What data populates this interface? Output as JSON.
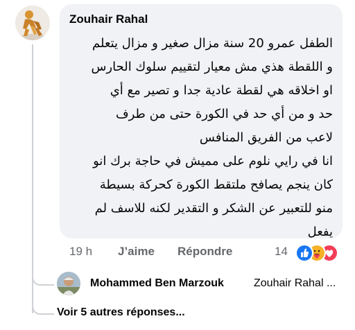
{
  "comment": {
    "author": "Zouhair Rahal",
    "text_lines": [
      "الطفل عمرو 20 سنة مزال صغير و مزال يتعلم",
      "و اللقطة هذي مش معيار لتقييم سلوك الحارس",
      "او اخلاقه هي لقطة عادية جدا و تصير مع أي",
      "حد و من أي حد في الكورة حتى من طرف",
      "لاعب من الفريق المنافس",
      "انا في رايي نلوم على مميش في حاجة برك انو",
      "كان ينجم يصافح ملتقط الكورة كحركة بسيطة",
      "منو للتعبير عن الشكر و التقدير لكنه للاسف لم",
      "يفعل"
    ],
    "time": "19 h",
    "like_label": "J’aime",
    "reply_label": "Répondre",
    "reactions": {
      "count": "14",
      "icons": [
        "like-icon",
        "care-icon",
        "love-icon"
      ],
      "colors": {
        "like": "#1877f2",
        "care": "#f7b125",
        "love": "#f33e58"
      }
    }
  },
  "reply": {
    "author": "Mohammed Ben Marzouk",
    "preview": "Zouhair Rahal ..."
  },
  "more_replies_label": "Voir 5 autres réponses..."
}
